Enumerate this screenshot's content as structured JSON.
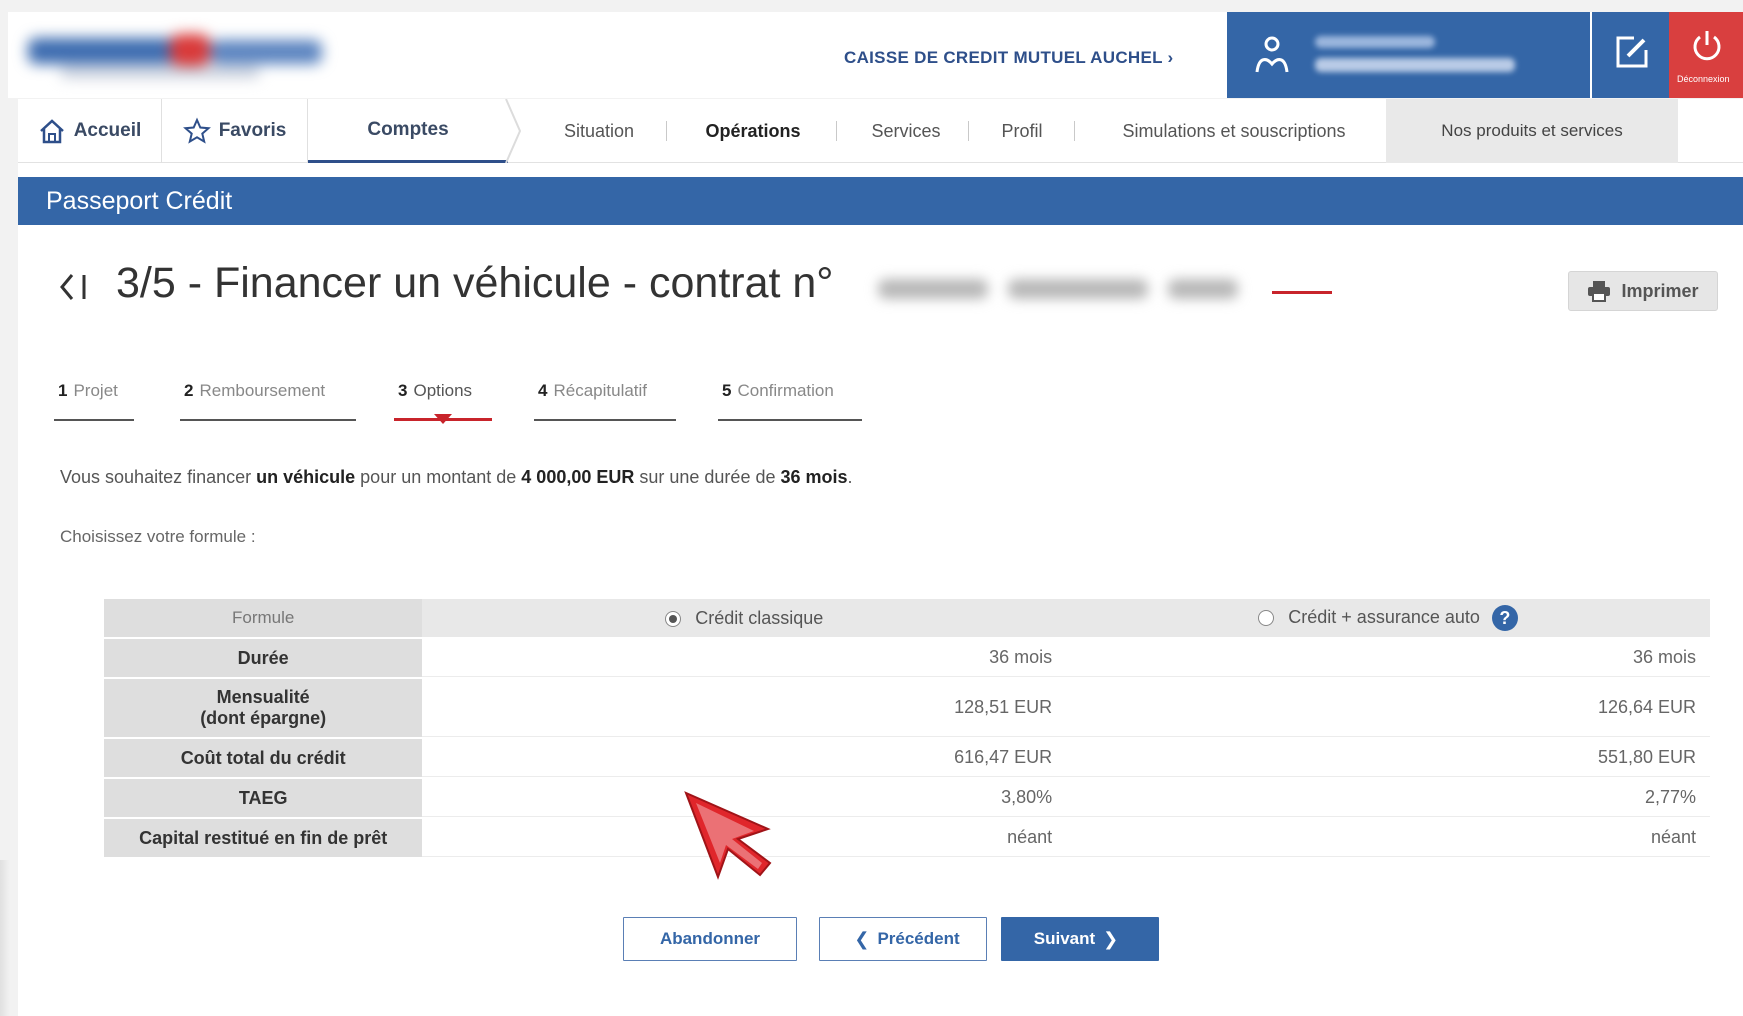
{
  "header": {
    "bank_branch": "CAISSE DE CREDIT MUTUEL AUCHEL ›",
    "logout_label": "Déconnexion"
  },
  "nav": {
    "accueil": "Accueil",
    "favoris": "Favoris",
    "comptes": "Comptes",
    "items": [
      "Situation",
      "Opérations",
      "Services",
      "Profil",
      "Simulations et souscriptions"
    ],
    "active": "Opérations",
    "products": "Nos produits et services"
  },
  "banner": {
    "title": "Passeport Crédit"
  },
  "page": {
    "title": "3/5 - Financer un véhicule - contrat n°",
    "print_label": "Imprimer"
  },
  "steps": [
    {
      "num": "1",
      "label": "Projet"
    },
    {
      "num": "2",
      "label": "Remboursement"
    },
    {
      "num": "3",
      "label": "Options"
    },
    {
      "num": "4",
      "label": "Récapitulatif"
    },
    {
      "num": "5",
      "label": "Confirmation"
    }
  ],
  "summary": {
    "part1": "Vous souhaitez financer ",
    "object": "un véhicule",
    "part2": " pour un montant de ",
    "amount": "4 000,00 EUR",
    "part3": " sur une durée de ",
    "duration": "36 mois",
    "part4": "."
  },
  "choose_label": "Choisissez votre formule :",
  "table": {
    "header_label": "Formule",
    "options": [
      {
        "label": "Crédit classique",
        "selected": true
      },
      {
        "label": "Crédit + assurance auto",
        "selected": false
      }
    ],
    "rows": [
      {
        "label": "Durée",
        "values": [
          "36 mois",
          "36 mois"
        ]
      },
      {
        "label": "Mensualité",
        "sublabel": "(dont épargne)",
        "values": [
          "128,51 EUR",
          "126,64 EUR"
        ]
      },
      {
        "label": "Coût total du crédit",
        "values": [
          "616,47 EUR",
          "551,80 EUR"
        ]
      },
      {
        "label": "TAEG",
        "values": [
          "3,80%",
          "2,77%"
        ]
      },
      {
        "label": "Capital restitué en fin de prêt",
        "values": [
          "néant",
          "néant"
        ]
      }
    ]
  },
  "buttons": {
    "abandon": "Abandonner",
    "previous": "Précédent",
    "next": "Suivant"
  },
  "colors": {
    "brand_blue": "#3466a7",
    "accent_red": "#c8242b",
    "logout_red": "#d93f3f"
  },
  "icons": {
    "home": "home-icon",
    "favorite": "star-icon",
    "user": "user-icon",
    "edit": "edit-icon",
    "logout": "power-icon",
    "print": "printer-icon",
    "help": "help-icon",
    "back": "back-icon"
  }
}
